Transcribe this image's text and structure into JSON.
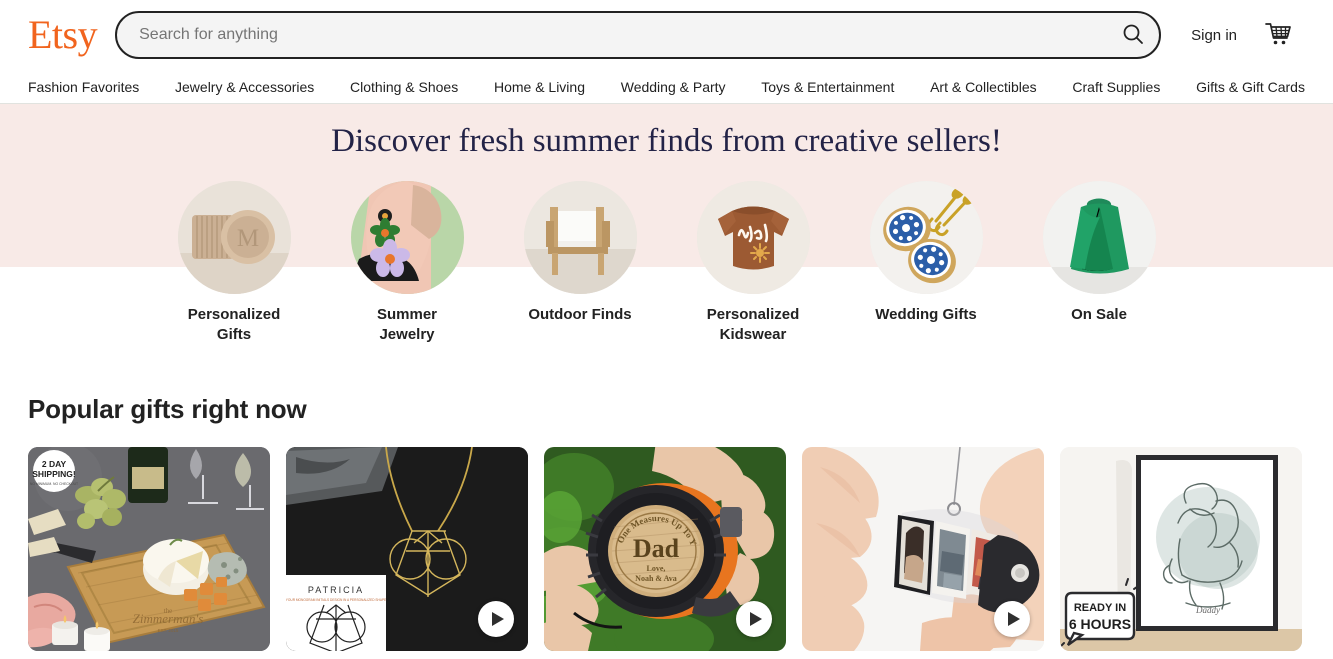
{
  "header": {
    "logo": "Etsy",
    "search": {
      "placeholder": "Search for anything",
      "value": "",
      "button_icon": "search-icon"
    },
    "sign_in": "Sign in",
    "cart_icon": "shopping-cart-icon"
  },
  "nav": {
    "items": [
      {
        "label": "Fashion Favorites"
      },
      {
        "label": "Jewelry & Accessories"
      },
      {
        "label": "Clothing & Shoes"
      },
      {
        "label": "Home & Living"
      },
      {
        "label": "Wedding & Party"
      },
      {
        "label": "Toys & Entertainment"
      },
      {
        "label": "Art & Collectibles"
      },
      {
        "label": "Craft Supplies"
      },
      {
        "label": "Gifts & Gift Cards"
      }
    ]
  },
  "banner": {
    "title": "Discover fresh summer finds from creative sellers!",
    "background_color": "#f8eae7",
    "categories": [
      {
        "label": "Personalized Gifts",
        "image": "monogram-wooden-trinket-box"
      },
      {
        "label": "Summer Jewelry",
        "image": "floral-statement-earrings-on-model"
      },
      {
        "label": "Outdoor Finds",
        "image": "wooden-outdoor-lounge-chair"
      },
      {
        "label": "Personalized Kidswear",
        "image": "brown-knit-kids-sweater-jack"
      },
      {
        "label": "Wedding Gifts",
        "image": "blue-oyster-shell-trinket-dishes"
      },
      {
        "label": "On Sale",
        "image": "green-knotted-tote-bag"
      }
    ]
  },
  "popular_gifts": {
    "title": "Popular gifts right now",
    "cards": [
      {
        "image": "engraved-cheese-charcuterie-board",
        "badge": {
          "line1": "2 DAY",
          "line2": "SHIPPING!",
          "line3": "NO MINIMUM. NO CHECKOUT"
        },
        "engraving": "Zimmerman's",
        "has_video": false
      },
      {
        "image": "gold-monogram-pendant-necklace",
        "inset_card_title": "PATRICIA",
        "inset_card_subtitle": "YOUR MONOGRAM INITIALS DESIGN IN A PERSONALIZED SHAPE",
        "has_video": true
      },
      {
        "image": "engraved-tape-measure-dad",
        "engraving_top": "No One Measures Up To You",
        "engraving_main": "Dad",
        "engraving_sub": "Love, Noah & Ava",
        "has_video": true
      },
      {
        "image": "mini-photo-album-keychain",
        "has_video": true
      },
      {
        "image": "framed-line-art-daddy-print",
        "badge": {
          "line1": "READY IN",
          "line2": "6 HOURS"
        },
        "signature": "Daddy",
        "has_video": false
      }
    ]
  },
  "colors": {
    "brand_orange": "#f1641e",
    "text_dark": "#222222",
    "banner_pink": "#f8eae7",
    "nav_border": "#e1e3df"
  }
}
